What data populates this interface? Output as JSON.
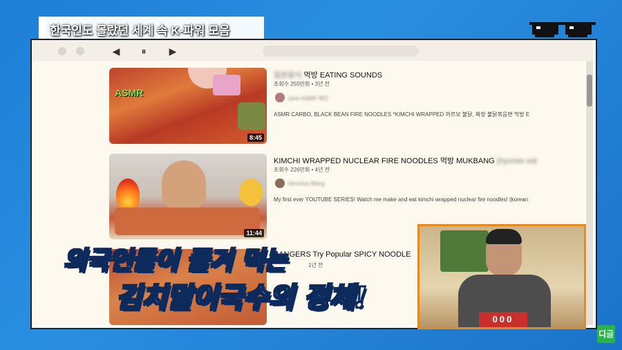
{
  "header": {
    "title": "한국인도 몰랐던 세계 속 K-파워 모음"
  },
  "media_controls": {
    "prev": "◀",
    "pause": "⏸",
    "next": "▶"
  },
  "videos": [
    {
      "title": "먹방 EATING SOUNDS",
      "title_blurred": "일본음식",
      "meta": "조회수 255만회 • 3년 전",
      "channel": "Jane ASMR 제인",
      "description": "ASMR CARBO, BLACK BEAN FIRE NOODLES *KIMCHI WRAPPED 까르보 불닭, 짜장 불닭볶음면 먹방 EATING SOU",
      "duration": "8:45",
      "thumb_label": "ASMR"
    },
    {
      "title": "KIMCHI WRAPPED NUCLEAR FIRE NOODLES 먹방 MUKBANG",
      "title_blurred": "(hyunee eat",
      "meta": "조회수 226만회 • 4년 전",
      "channel": "Veronica Wang",
      "description": "My first ever YOUTUBE SERIES! Watch me make and eat kimchi wrapped nuclear fire noodles! (korean cabbag",
      "duration": "11:44"
    },
    {
      "title": "BANGERS Try Popular SPICY NOODLE",
      "meta": "1년 전"
    }
  ],
  "subtitles": {
    "line1": "외국인들이 즐겨 먹는",
    "line2": "김치말이국수의 정체!"
  },
  "inset": {
    "counter": "000"
  },
  "logo": {
    "text": "디글"
  },
  "colors": {
    "background": "#1d7fd6",
    "inset_border": "#e68a1e",
    "logo": "#2bb24c",
    "subtitle_outline": "#0d2a5c"
  }
}
